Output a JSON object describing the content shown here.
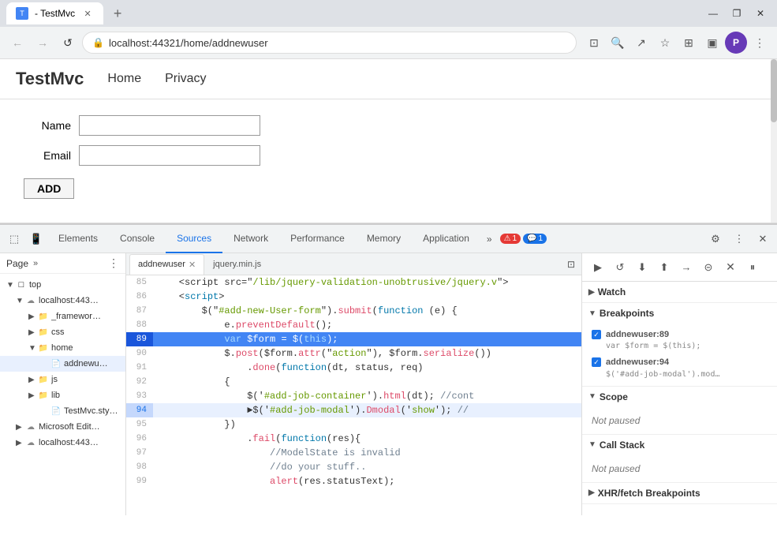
{
  "browser": {
    "tab_title": "- TestMvc",
    "tab_favicon": "T",
    "new_tab_icon": "+",
    "window_min": "—",
    "window_max": "❐",
    "window_close": "✕"
  },
  "navbar": {
    "back": "←",
    "forward": "→",
    "refresh": "↺",
    "url": "localhost:44321/home/addnewuser",
    "lock_icon": "🔒"
  },
  "page": {
    "site_title": "TestMvc",
    "nav_home": "Home",
    "nav_privacy": "Privacy",
    "form": {
      "name_label": "Name",
      "email_label": "Email",
      "add_button": "ADD"
    }
  },
  "devtools": {
    "tabs": [
      {
        "label": "Elements",
        "active": false
      },
      {
        "label": "Console",
        "active": false
      },
      {
        "label": "Sources",
        "active": true
      },
      {
        "label": "Network",
        "active": false
      },
      {
        "label": "Performance",
        "active": false
      },
      {
        "label": "Memory",
        "active": false
      },
      {
        "label": "Application",
        "active": false
      }
    ],
    "more_label": "»",
    "badge_red": "1",
    "badge_blue": "1",
    "editor_tabs": [
      {
        "label": "addnewuser",
        "active": true,
        "has_close": true
      },
      {
        "label": "jquery.min.js",
        "active": false,
        "has_close": false
      }
    ],
    "sources_tree": {
      "header": "Page",
      "items": [
        {
          "label": "top",
          "indent": 0,
          "type": "root",
          "arrow": "▼"
        },
        {
          "label": "localhost:443…",
          "indent": 1,
          "type": "host",
          "arrow": "▼"
        },
        {
          "label": "_framewor…",
          "indent": 2,
          "type": "folder",
          "arrow": "▶"
        },
        {
          "label": "css",
          "indent": 2,
          "type": "folder",
          "arrow": "▶"
        },
        {
          "label": "home",
          "indent": 2,
          "type": "folder",
          "arrow": "▼"
        },
        {
          "label": "addnewu…",
          "indent": 3,
          "type": "file",
          "selected": true
        },
        {
          "label": "js",
          "indent": 2,
          "type": "folder",
          "arrow": "▶"
        },
        {
          "label": "lib",
          "indent": 2,
          "type": "folder",
          "arrow": "▶"
        },
        {
          "label": "TestMvc.sty…",
          "indent": 2,
          "type": "file"
        },
        {
          "label": "Microsoft Edit…",
          "indent": 1,
          "type": "host",
          "arrow": "▶"
        },
        {
          "label": "localhost:443…",
          "indent": 1,
          "type": "host2",
          "arrow": "▶"
        }
      ]
    },
    "code_lines": [
      {
        "num": "85",
        "text": "    <script src=\"/lib/jquery-validation-unobtrusive/jquery.v",
        "active": false
      },
      {
        "num": "86",
        "text": "    <script>",
        "active": false
      },
      {
        "num": "87",
        "text": "        $(\"#add-new-User-form\").submit(function (e) {",
        "active": false
      },
      {
        "num": "88",
        "text": "            e.preventDefault();",
        "active": false
      },
      {
        "num": "89",
        "text": "            var $form = $(this);",
        "active": true
      },
      {
        "num": "90",
        "text": "            $.post($form.attr(\"action\"), $form.serialize())",
        "active": false
      },
      {
        "num": "91",
        "text": "                .done(function(dt, status, req)",
        "active": false
      },
      {
        "num": "92",
        "text": "            {",
        "active": false
      },
      {
        "num": "93",
        "text": "                $('#add-job-container').html(dt); //cont",
        "active": false
      },
      {
        "num": "94",
        "text": "                $('#add-job-modal').D​modal('show'); //",
        "active": true
      },
      {
        "num": "95",
        "text": "            })",
        "active": false
      },
      {
        "num": "96",
        "text": "                .fail(function(res){",
        "active": false
      },
      {
        "num": "97",
        "text": "                    //ModelState is invalid",
        "active": false
      },
      {
        "num": "98",
        "text": "                    //do your stuff..",
        "active": false
      },
      {
        "num": "99",
        "text": "                    alert(res.statusText);",
        "active": false
      }
    ],
    "right_panel": {
      "toolbar_buttons": [
        "▶",
        "⟳",
        "⬇",
        "⬆",
        "⇥",
        "⇤",
        "☰",
        "⏸"
      ],
      "watch_label": "Watch",
      "breakpoints_label": "Breakpoints",
      "breakpoints": [
        {
          "location": "addnewuser:89",
          "code": "var $form = $(this);"
        },
        {
          "location": "addnewuser:94",
          "code": "$('#add-job-modal').mod…"
        }
      ],
      "scope_label": "Scope",
      "scope_status": "Not paused",
      "callstack_label": "Call Stack",
      "callstack_status": "Not paused",
      "xhr_label": "XHR/fetch Breakpoints"
    }
  }
}
